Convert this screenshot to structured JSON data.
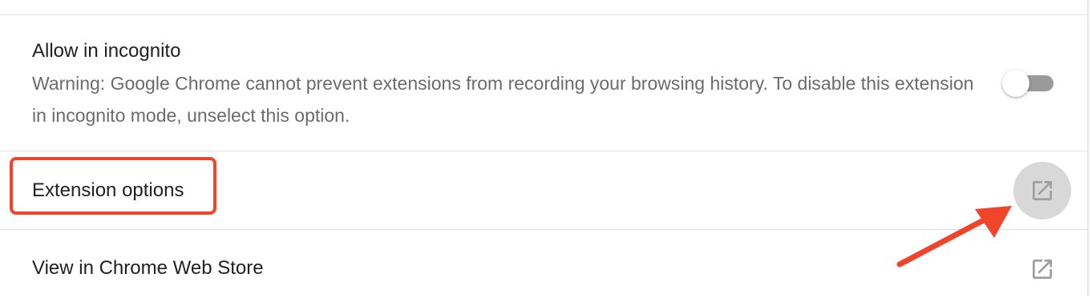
{
  "incognito": {
    "title": "Allow in incognito",
    "description": "Warning: Google Chrome cannot prevent extensions from recording your browsing history. To disable this extension in incognito mode, unselect this option.",
    "toggle_on": false
  },
  "options": {
    "title": "Extension options",
    "icon": "open-in-new-icon"
  },
  "webstore": {
    "title": "View in Chrome Web Store",
    "icon": "open-in-new-icon"
  },
  "colors": {
    "annotation": "#f0442b",
    "toggle_track": "#9a9a9a",
    "icon": "#9e9e9e",
    "hover_circle": "#d8d8d8"
  }
}
